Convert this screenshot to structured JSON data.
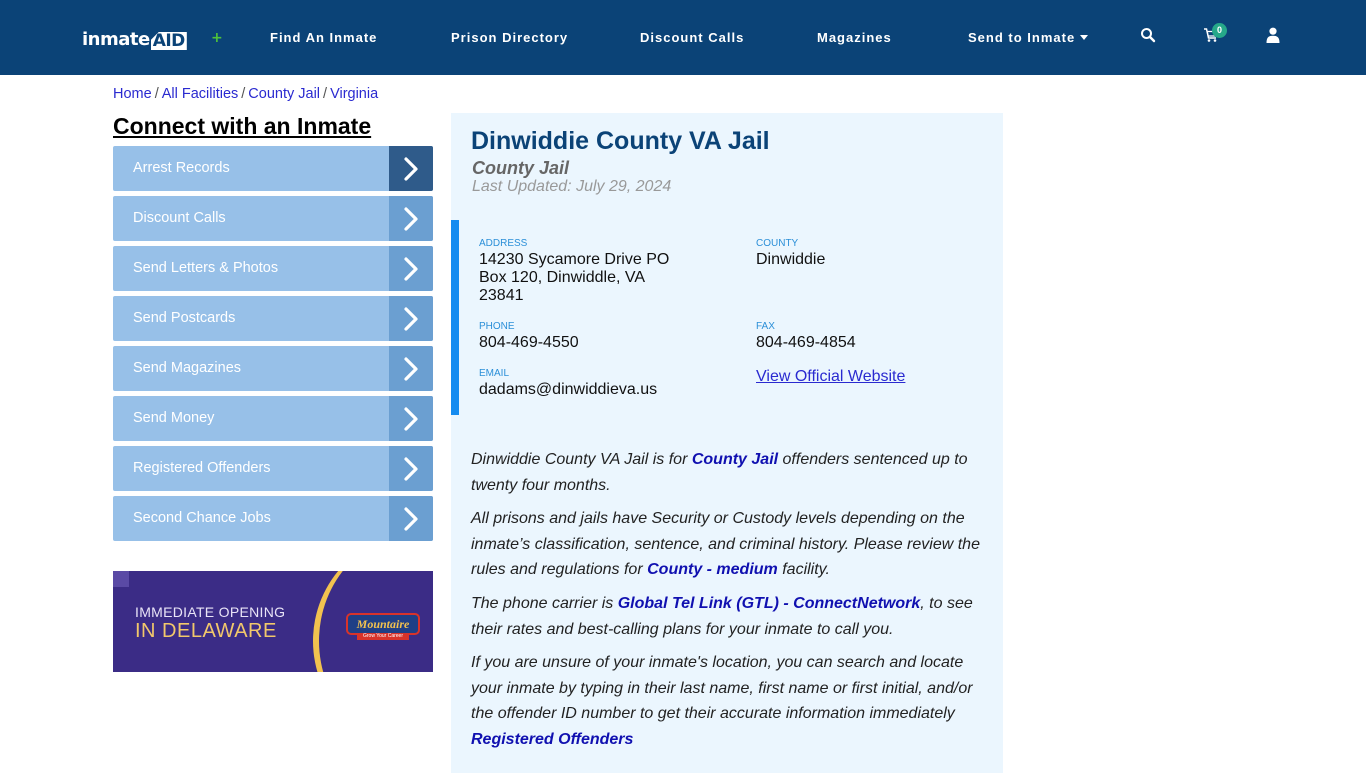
{
  "header": {
    "logo_text": "inmate",
    "logo_accent": "AID",
    "nav": [
      {
        "label": "Find An Inmate"
      },
      {
        "label": "Prison Directory"
      },
      {
        "label": "Discount Calls"
      },
      {
        "label": "Magazines"
      },
      {
        "label": "Send to Inmate"
      }
    ],
    "cart_count": "0",
    "icons": [
      "search-icon",
      "cart-icon",
      "user-icon"
    ]
  },
  "breadcrumb": [
    {
      "label": "Home"
    },
    {
      "label": "All Facilities"
    },
    {
      "label": "County Jail"
    },
    {
      "label": "Virginia"
    }
  ],
  "breadcrumb_separator": "/",
  "sidebar": {
    "title": "Connect with an Inmate",
    "items": [
      {
        "label": "Arrest Records"
      },
      {
        "label": "Discount Calls"
      },
      {
        "label": "Send Letters & Photos"
      },
      {
        "label": "Send Postcards"
      },
      {
        "label": "Send Magazines"
      },
      {
        "label": "Send Money"
      },
      {
        "label": "Registered Offenders"
      },
      {
        "label": "Second Chance Jobs"
      }
    ],
    "ad": {
      "line1": "IMMEDIATE OPENING",
      "line2": "IN DELAWARE",
      "brand": "Mountaire",
      "brand_sub": "Grow Your Career"
    }
  },
  "facility": {
    "name": "Dinwiddie County VA Jail",
    "type": "County Jail",
    "last_updated": "Last Updated: July 29, 2024",
    "address_label": "ADDRESS",
    "address_lines": [
      "14230 Sycamore Drive PO",
      "Box 120, Dinwiddle, VA",
      "23841"
    ],
    "county_label": "COUNTY",
    "county": "Dinwiddie",
    "phone_label": "PHONE",
    "phone": "804-469-4550",
    "fax_label": "FAX",
    "fax": "804-469-4854",
    "email_label": "EMAIL",
    "email": "dadams@dinwiddieva.us",
    "website_link": "View Official Website"
  },
  "description": {
    "p1_pre": "Dinwiddie County VA Jail is for ",
    "p1_link": "County Jail",
    "p1_post": " offenders sentenced up to twenty four months.",
    "p2_pre": "All prisons and jails have Security or Custody levels depending on the inmate’s classification, sentence, and criminal history. Please review the rules and regulations for ",
    "p2_link": "County - medium",
    "p2_post": " facility.",
    "p3_pre": "The phone carrier is ",
    "p3_link": "Global Tel Link (GTL) - ConnectNetwork",
    "p3_post": ", to see their rates and best-calling plans for your inmate to call you.",
    "p4_text": "If you are unsure of your inmate's location, you can search and locate your inmate by typing in their last name, first name or first initial, and/or the offender ID number to get their accurate information immediately",
    "p4_link": "Registered Offenders"
  },
  "colors": {
    "header_bg": "#0b4377",
    "sidebar_button": "#97c0e8",
    "sidebar_arrow": "#6b9fd1",
    "sidebar_arrow_active": "#2f5b8a",
    "panel_bg": "#ebf6fe",
    "accent_bar": "#168cf0",
    "badge": "#26a889"
  }
}
